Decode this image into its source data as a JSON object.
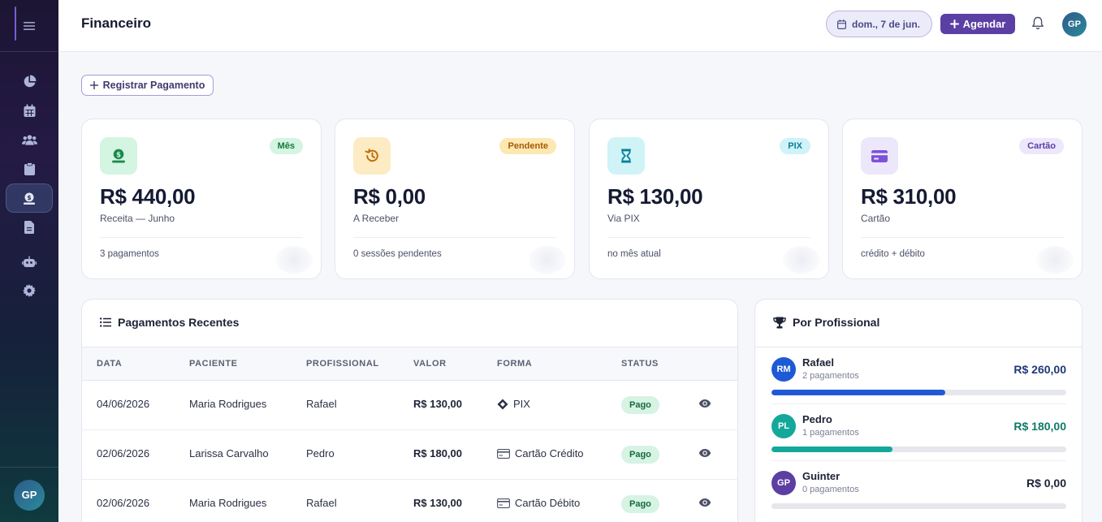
{
  "header": {
    "title": "Financeiro",
    "date_label": "dom., 7 de jun.",
    "agendar_label": "Agendar",
    "avatar_initials": "GP"
  },
  "sidebar": {
    "avatar_initials": "GP",
    "items": [
      {
        "icon": "chart-pie-icon",
        "active": false
      },
      {
        "icon": "calendar-icon",
        "active": false
      },
      {
        "icon": "users-icon",
        "active": false
      },
      {
        "icon": "clipboard-icon",
        "active": false
      },
      {
        "icon": "money-icon",
        "active": true
      },
      {
        "icon": "file-icon",
        "active": false
      },
      {
        "icon": "robot-icon",
        "active": false
      },
      {
        "icon": "gear-icon",
        "active": false
      }
    ]
  },
  "register_button": "Registrar Pagamento",
  "cards": [
    {
      "badge": "Mês",
      "amount": "R$ 440,00",
      "sub": "Receita — Junho",
      "foot": "3 pagamentos",
      "icon": "money-icon",
      "color": "#16a34a"
    },
    {
      "badge": "Pendente",
      "amount": "R$ 0,00",
      "sub": "A Receber",
      "foot": "0 sessões pendentes",
      "icon": "history-icon",
      "color": "#d97706"
    },
    {
      "badge": "PIX",
      "amount": "R$ 130,00",
      "sub": "Via PIX",
      "foot": "no mês atual",
      "icon": "hourglass-icon",
      "color": "#0891b2"
    },
    {
      "badge": "Cartão",
      "amount": "R$ 310,00",
      "sub": "Cartão",
      "foot": "crédito + débito",
      "icon": "credit-card-icon",
      "color": "#7c3aed"
    }
  ],
  "payments": {
    "title": "Pagamentos Recentes",
    "columns": [
      "DATA",
      "PACIENTE",
      "PROFISSIONAL",
      "VALOR",
      "FORMA",
      "STATUS"
    ],
    "rows": [
      {
        "data": "04/06/2026",
        "paciente": "Maria Rodrigues",
        "profissional": "Rafael",
        "valor": "R$ 130,00",
        "forma": "PIX",
        "forma_icon": "pix-icon",
        "status": "Pago"
      },
      {
        "data": "02/06/2026",
        "paciente": "Larissa Carvalho",
        "profissional": "Pedro",
        "valor": "R$ 180,00",
        "forma": "Cartão Crédito",
        "forma_icon": "credit-card-icon",
        "status": "Pago"
      },
      {
        "data": "02/06/2026",
        "paciente": "Maria Rodrigues",
        "profissional": "Rafael",
        "valor": "R$ 130,00",
        "forma": "Cartão Débito",
        "forma_icon": "credit-card-icon",
        "status": "Pago"
      }
    ]
  },
  "professionals": {
    "title": "Por Profissional",
    "items": [
      {
        "initials": "RM",
        "name": "Rafael",
        "count": "2 pagamentos",
        "value": "R$ 260,00",
        "share": 0.59,
        "color": "#1e5ad6",
        "value_color": "#1d3a7a"
      },
      {
        "initials": "PL",
        "name": "Pedro",
        "count": "1 pagamentos",
        "value": "R$ 180,00",
        "share": 0.41,
        "color": "#14a89a",
        "value_color": "#0f7a6a"
      },
      {
        "initials": "GP",
        "name": "Guinter",
        "count": "0 pagamentos",
        "value": "R$ 0,00",
        "share": 0.0,
        "color": "#5b3fa3",
        "value_color": "#1d2236"
      }
    ]
  }
}
